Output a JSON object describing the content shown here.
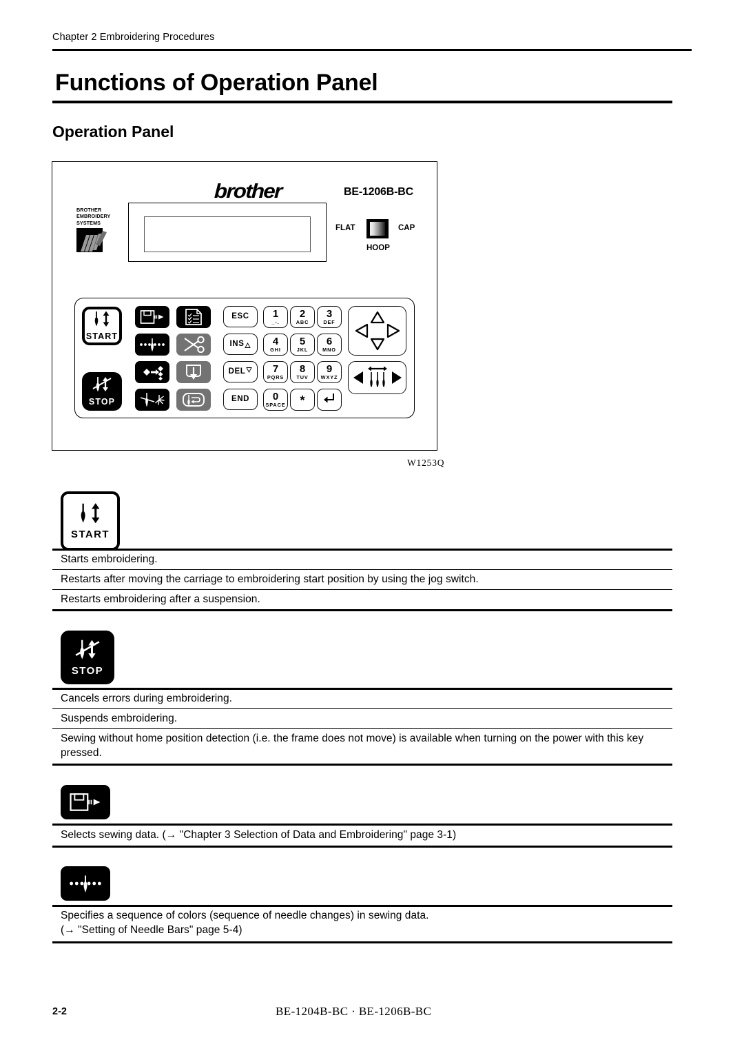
{
  "header": {
    "running_head": "Chapter 2 Embroidering Procedures",
    "chapter_title": "Functions of Operation Panel",
    "section_heading": "Operation Panel"
  },
  "figure": {
    "caption": "W1253Q",
    "brand_logo": "brother",
    "model_number": "BE-1206B-BC",
    "brand_mark_lines": "BROTHER\nEMBROIDERY\nSYSTEMS",
    "brand_mark_line1": "BROTHER",
    "brand_mark_line2": "EMBROIDERY",
    "brand_mark_line3": "SYSTEMS",
    "hoop_switch": {
      "left_label": "FLAT",
      "right_label": "CAP",
      "bottom_label": "HOOP"
    },
    "keys": {
      "start": "START",
      "stop": "STOP",
      "esc": "ESC",
      "ins": "INS",
      "del": "DEL",
      "end": "END",
      "numeric": [
        {
          "digit": "1",
          "letters": "_-."
        },
        {
          "digit": "2",
          "letters": "ABC"
        },
        {
          "digit": "3",
          "letters": "DEF"
        },
        {
          "digit": "4",
          "letters": "GHI"
        },
        {
          "digit": "5",
          "letters": "JKL"
        },
        {
          "digit": "6",
          "letters": "MNO"
        },
        {
          "digit": "7",
          "letters": "PQRS"
        },
        {
          "digit": "8",
          "letters": "TUV"
        },
        {
          "digit": "9",
          "letters": "WXYZ"
        },
        {
          "digit": "0",
          "letters": "SPACE"
        },
        {
          "digit": "*",
          "letters": ""
        }
      ]
    }
  },
  "key_descriptions": [
    {
      "key": "start",
      "lines": [
        "Starts embroidering.",
        "Restarts after moving the carriage to embroidering start position by using the jog switch.",
        "Restarts embroidering after a suspension."
      ]
    },
    {
      "key": "stop",
      "lines": [
        "Cancels errors during embroidering.",
        "Suspends embroidering.",
        "Sewing without home position detection (i.e. the frame does not move) is available when turning on the power with this key pressed."
      ]
    },
    {
      "key": "select-data",
      "lines": [
        "Selects sewing data. (→ \"Chapter 3 Selection of Data and Embroidering\" page 3-1)"
      ]
    },
    {
      "key": "needle-bar",
      "lines": [
        "Specifies a sequence of colors (sequence of needle changes) in sewing data.",
        "(→ \"Setting of Needle Bars\" page 5-4)"
      ]
    }
  ],
  "footer": {
    "page_number": "2-2",
    "models": "BE-1204B-BC · BE-1206B-BC"
  }
}
